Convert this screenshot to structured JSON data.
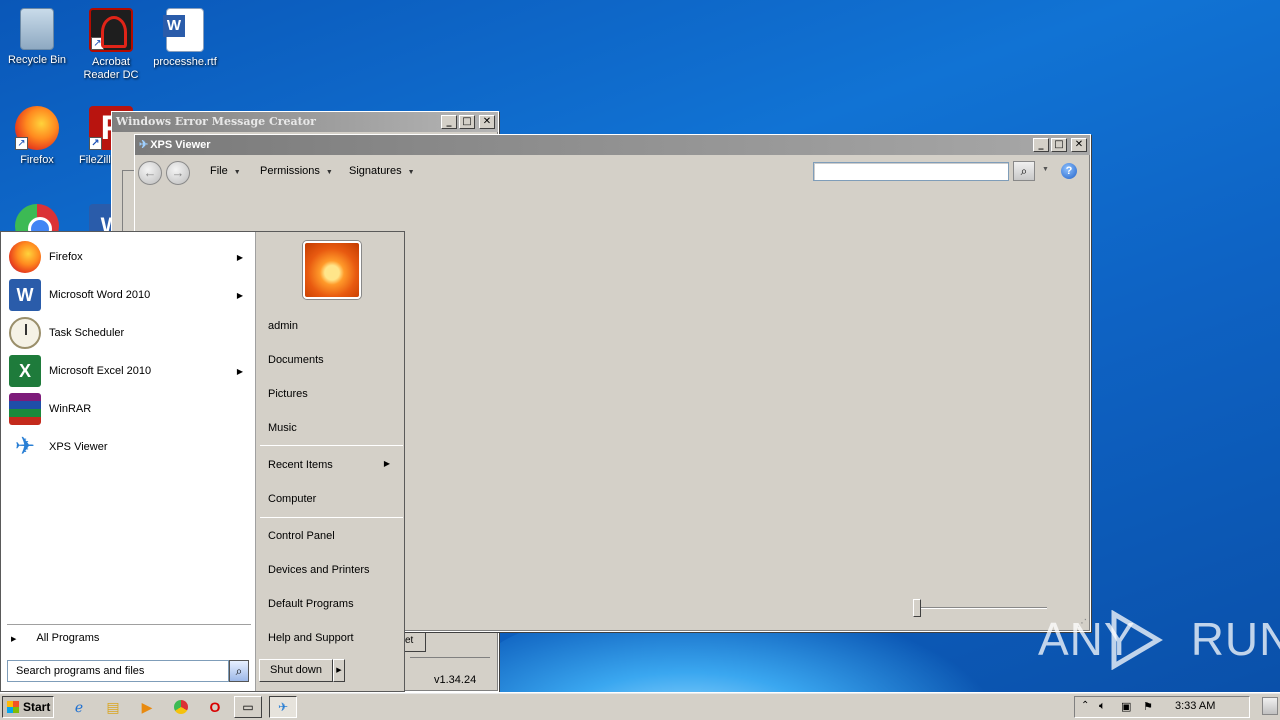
{
  "desktop": {
    "icons": [
      {
        "label": "Recycle Bin",
        "icon": "recycle-bin-icon"
      },
      {
        "label": "Acrobat Reader DC",
        "icon": "acrobat-reader-icon"
      },
      {
        "label": "processhe.rtf",
        "icon": "word-document-icon"
      },
      {
        "label": "Firefox",
        "icon": "firefox-icon"
      },
      {
        "label": "FileZilla",
        "icon": "filezilla-icon"
      },
      {
        "label": "",
        "icon": "chrome-icon"
      },
      {
        "label": "",
        "icon": "word-icon"
      }
    ],
    "watermark": "ANY RUN"
  },
  "error_window": {
    "title": "Windows Error Message Creator",
    "version": "v1.34.24",
    "partial_button": "et"
  },
  "xps_viewer": {
    "title": "XPS Viewer",
    "menus": [
      "File",
      "Permissions",
      "Signatures"
    ],
    "search_value": ""
  },
  "start_menu": {
    "programs": [
      {
        "label": "Firefox",
        "has_submenu": true
      },
      {
        "label": "Microsoft Word 2010",
        "has_submenu": true
      },
      {
        "label": "Task Scheduler",
        "has_submenu": false
      },
      {
        "label": "Microsoft Excel 2010",
        "has_submenu": true
      },
      {
        "label": "WinRAR",
        "has_submenu": false
      },
      {
        "label": "XPS Viewer",
        "has_submenu": false
      }
    ],
    "all_programs": "All Programs",
    "search_placeholder": "Search programs and files",
    "right": {
      "user": "admin",
      "documents": "Documents",
      "pictures": "Pictures",
      "music": "Music",
      "recent_items": "Recent Items",
      "computer": "Computer",
      "control_panel": "Control Panel",
      "devices_printers": "Devices and Printers",
      "default_programs": "Default Programs",
      "help_support": "Help and Support"
    },
    "shutdown": "Shut down"
  },
  "taskbar": {
    "start_label": "Start",
    "clock": "3:33 AM"
  }
}
